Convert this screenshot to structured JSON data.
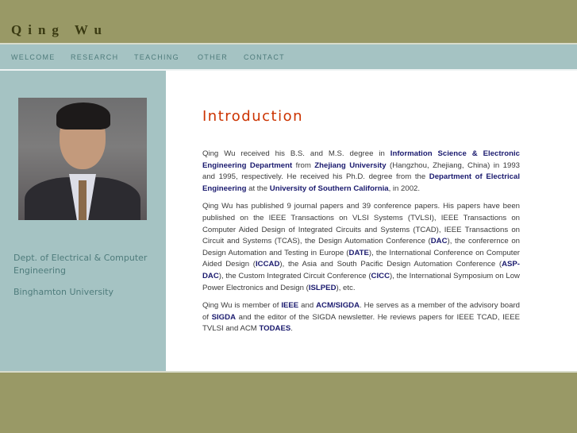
{
  "header": {
    "title": "Qing Wu"
  },
  "nav": [
    {
      "label": "WELCOME"
    },
    {
      "label": "RESEARCH"
    },
    {
      "label": "TEACHING"
    },
    {
      "label": "OTHER"
    },
    {
      "label": "CONTACT"
    }
  ],
  "sidebar": {
    "department": "Dept. of Electrical & Computer Engineering",
    "university": "Binghamton University"
  },
  "main": {
    "title": "Introduction",
    "paragraphs": [
      [
        {
          "t": "Qing Wu received his B.S. and M.S. degree in "
        },
        {
          "t": "Information Science & Electronic Engineering Department",
          "link": true
        },
        {
          "t": " from "
        },
        {
          "t": "Zhejiang University",
          "link": true
        },
        {
          "t": " (Hangzhou, Zhejiang, China) in 1993 and 1995, respectively. He received his Ph.D. degree from the "
        },
        {
          "t": "Department of Electrical Engineering",
          "link": true
        },
        {
          "t": " at the "
        },
        {
          "t": "University of Southern California",
          "link": true
        },
        {
          "t": ", in 2002."
        }
      ],
      [
        {
          "t": "Qing Wu has published 9 journal papers and 39 conference papers. His papers have been published on the IEEE Transactions on VLSI Systems (TVLSI), IEEE Transactions on Computer Aided Design of Integrated Circuits and Systems (TCAD), IEEE Transactions on Circuit and Systems (TCAS), the Design Automation Conference ("
        },
        {
          "t": "DAC",
          "link": true
        },
        {
          "t": "), the conferernce on Design Automation and Testing in Europe ("
        },
        {
          "t": "DATE",
          "link": true
        },
        {
          "t": "), the International Conference on Computer Aided Design ("
        },
        {
          "t": "ICCAD",
          "link": true
        },
        {
          "t": "), the Asia and South Pacific Design Automation Conference ("
        },
        {
          "t": "ASP-DAC",
          "link": true
        },
        {
          "t": "), the Custom Integrated Circuit Conference ("
        },
        {
          "t": "CICC",
          "link": true
        },
        {
          "t": "), the International Symposium on Low Power Electronics and Design ("
        },
        {
          "t": "ISLPED",
          "link": true
        },
        {
          "t": "), etc."
        }
      ],
      [
        {
          "t": "Qing Wu is member of "
        },
        {
          "t": "IEEE",
          "link": true
        },
        {
          "t": " and "
        },
        {
          "t": "ACM/SIGDA",
          "link": true
        },
        {
          "t": ". He serves as a member of the advisory board of "
        },
        {
          "t": "SIGDA",
          "link": true
        },
        {
          "t": " and the editor of the SIGDA newsletter. He reviews papers for IEEE TCAD, IEEE TVLSI and ACM "
        },
        {
          "t": "TODAES",
          "link": true
        },
        {
          "t": "."
        }
      ]
    ]
  },
  "colors": {
    "header": "#999966",
    "nav": "#a5c3c3",
    "title": "#cc3300",
    "link": "#1a1a6e"
  }
}
